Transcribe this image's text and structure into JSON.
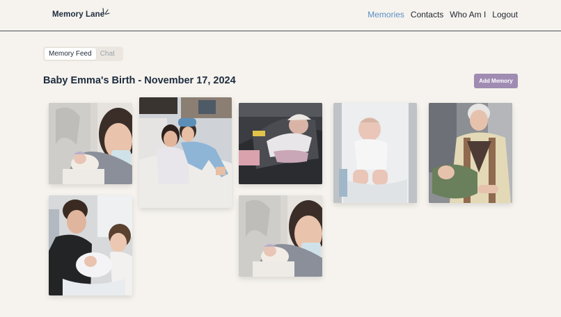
{
  "header": {
    "logo_text": "Memory Lane",
    "nav": [
      {
        "label": "Memories"
      },
      {
        "label": "Contacts"
      },
      {
        "label": "Who Am I"
      },
      {
        "label": "Logout"
      }
    ],
    "accent_color": "#5b8fc4"
  },
  "tabs": [
    {
      "label": "Memory Feed"
    },
    {
      "label": "Chat"
    }
  ],
  "memory": {
    "title": "Baby Emma's Birth - November 17, 2024",
    "add_button_label": "Add Memory",
    "button_color": "#a08cb2"
  },
  "photos": [
    {
      "subject": "hospital selfie with newborn"
    },
    {
      "subject": "mother in hospital bed with visitor"
    },
    {
      "subject": "newborn in car seat"
    },
    {
      "subject": "newborn in bassinet"
    },
    {
      "subject": "great-grandmother holding newborn"
    },
    {
      "subject": "mother and toddler with newborn"
    },
    {
      "subject": "hospital selfie with newborn"
    }
  ]
}
